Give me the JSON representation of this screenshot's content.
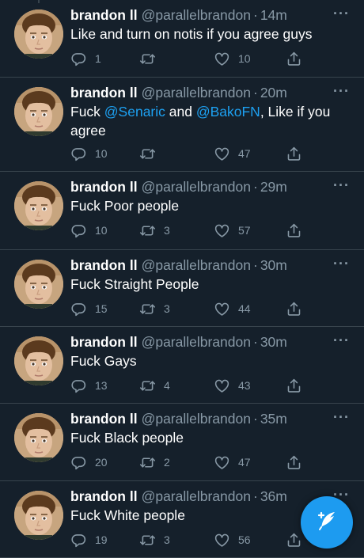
{
  "tweets": [
    {
      "name": "brandon ll",
      "handle": "@parallelbrandon",
      "sep": "·",
      "time": "14m",
      "segments": [
        {
          "t": "Like and turn on notis if you agree guys",
          "m": false
        }
      ],
      "reply": "1",
      "retweets": "",
      "likes": "10"
    },
    {
      "name": "brandon ll",
      "handle": "@parallelbrandon",
      "sep": "·",
      "time": "20m",
      "segments": [
        {
          "t": "Fuck ",
          "m": false
        },
        {
          "t": "@Senaric",
          "m": true
        },
        {
          "t": " and ",
          "m": false
        },
        {
          "t": "@BakoFN",
          "m": true
        },
        {
          "t": ", Like if you agree",
          "m": false
        }
      ],
      "reply": "10",
      "retweets": "",
      "likes": "47"
    },
    {
      "name": "brandon ll",
      "handle": "@parallelbrandon",
      "sep": "·",
      "time": "29m",
      "segments": [
        {
          "t": "Fuck Poor people",
          "m": false
        }
      ],
      "reply": "10",
      "retweets": "3",
      "likes": "57"
    },
    {
      "name": "brandon ll",
      "handle": "@parallelbrandon",
      "sep": "·",
      "time": "30m",
      "segments": [
        {
          "t": "Fuck Straight People",
          "m": false
        }
      ],
      "reply": "15",
      "retweets": "3",
      "likes": "44"
    },
    {
      "name": "brandon ll",
      "handle": "@parallelbrandon",
      "sep": "·",
      "time": "30m",
      "segments": [
        {
          "t": "Fuck Gays",
          "m": false
        }
      ],
      "reply": "13",
      "retweets": "4",
      "likes": "43"
    },
    {
      "name": "brandon ll",
      "handle": "@parallelbrandon",
      "sep": "·",
      "time": "35m",
      "segments": [
        {
          "t": "Fuck Black people",
          "m": false
        }
      ],
      "reply": "20",
      "retweets": "2",
      "likes": "47"
    },
    {
      "name": "brandon ll",
      "handle": "@parallelbrandon",
      "sep": "·",
      "time": "36m",
      "segments": [
        {
          "t": "Fuck White people",
          "m": false
        }
      ],
      "reply": "19",
      "retweets": "3",
      "likes": "56"
    }
  ],
  "icons": {
    "more": "more-options-icon",
    "reply": "reply-icon",
    "retweet": "retweet-icon",
    "like": "heart-icon",
    "share": "share-icon",
    "compose": "compose-tweet-icon"
  },
  "colors": {
    "background": "#15202b",
    "divider": "#38444d",
    "secondary_text": "#8899a6",
    "mention": "#1da1f2",
    "fab": "#1d9bf0"
  }
}
